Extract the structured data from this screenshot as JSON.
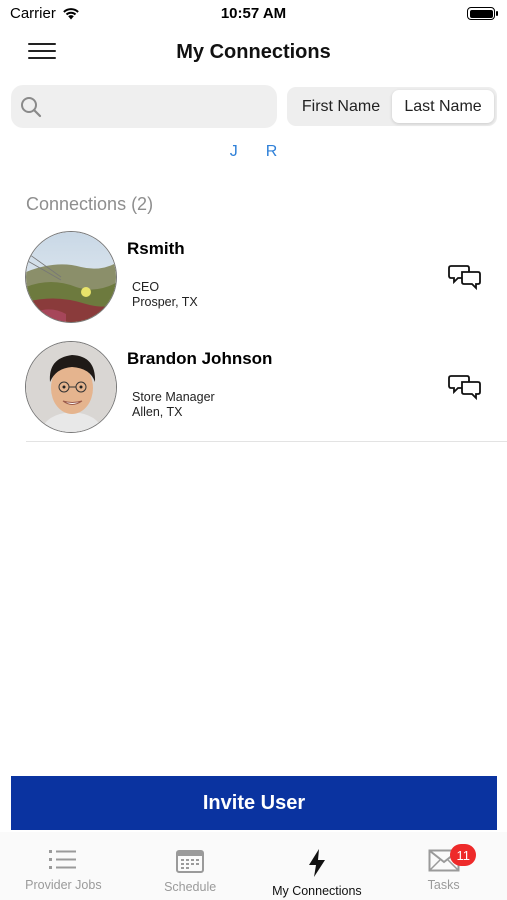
{
  "status_bar": {
    "carrier": "Carrier",
    "time": "10:57 AM"
  },
  "nav": {
    "title": "My Connections",
    "menu_icon": "hamburger-menu-icon"
  },
  "search": {
    "placeholder": "",
    "value": ""
  },
  "sort": {
    "options": [
      "First Name",
      "Last Name"
    ],
    "selected": "Last Name"
  },
  "alphabet": [
    "J",
    "R"
  ],
  "section": {
    "title": "Connections (2)"
  },
  "connections": [
    {
      "name": "Rsmith",
      "title": "CEO",
      "location": "Prosper, TX",
      "avatar": "landscape-photo",
      "action_icon": "chat-bubbles-icon"
    },
    {
      "name": "Brandon Johnson",
      "title": "Store Manager",
      "location": "Allen, TX",
      "avatar": "person-photo",
      "action_icon": "chat-bubbles-icon"
    }
  ],
  "invite": {
    "label": "Invite User",
    "color": "#0a33a0"
  },
  "tabs": [
    {
      "label": "Provider Jobs",
      "icon": "list-icon",
      "active": false
    },
    {
      "label": "Schedule",
      "icon": "calendar-icon",
      "active": false
    },
    {
      "label": "My Connections",
      "icon": "lightning-icon",
      "active": true
    },
    {
      "label": "Tasks",
      "icon": "envelope-icon",
      "active": false,
      "badge": "11"
    }
  ],
  "colors": {
    "accent": "#2f80d8",
    "badge": "#ee2a2a",
    "muted": "#8e8e8e"
  }
}
